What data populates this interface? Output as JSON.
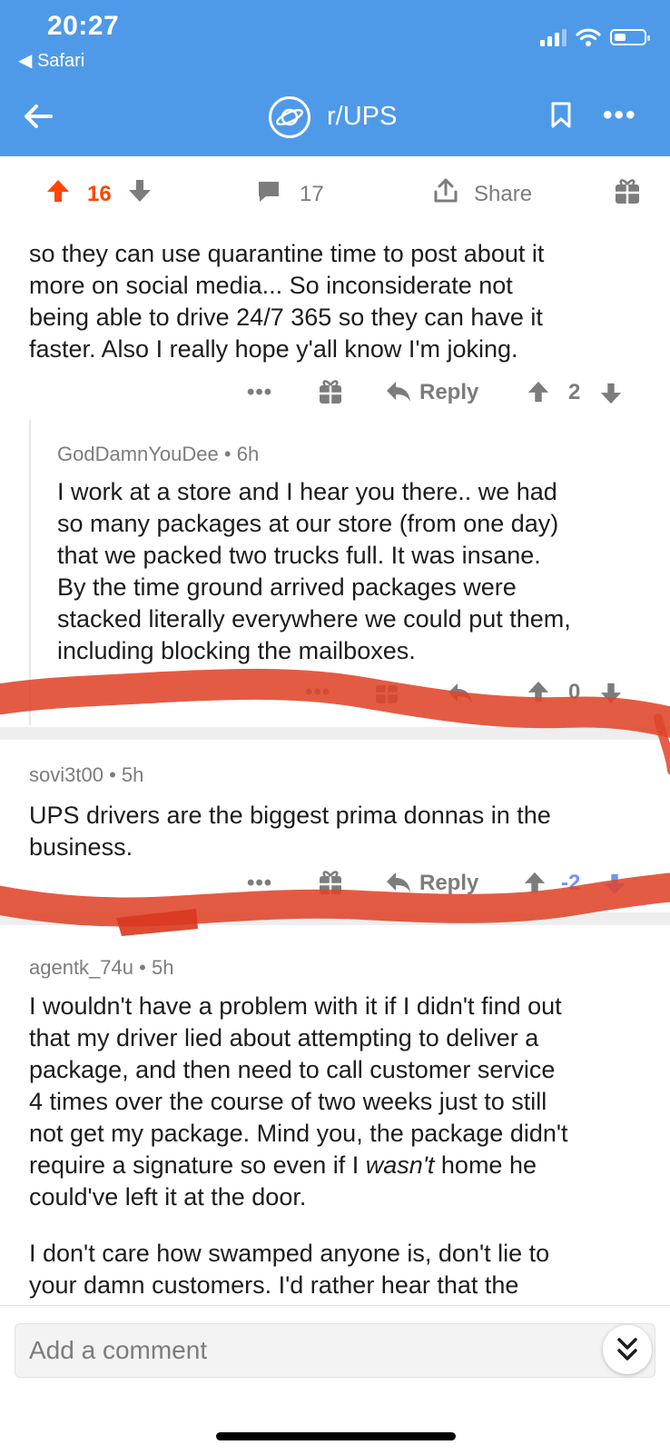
{
  "status_bar": {
    "time": "20:27",
    "back_app": "◀ Safari"
  },
  "header": {
    "subreddit": "r/UPS"
  },
  "post_bar": {
    "upvotes": "16",
    "comments": "17",
    "share_label": "Share"
  },
  "comments": [
    {
      "text_lines": [
        "so they can use quarantine time to post about it",
        "more on social media... So inconsiderate not",
        "being able to drive 24/7 365 so they can have it",
        "faster. Also I really hope y'all know I'm joking."
      ],
      "reply_label": "Reply",
      "score": "2"
    },
    {
      "author": "GodDamnYouDee",
      "age": "6h",
      "text_lines": [
        "I work at a store and I hear you there.. we had",
        "so many packages at our store (from one day)",
        "that we packed two trucks full. It was insane.",
        "By the time ground arrived packages were",
        "stacked literally everywhere we could put them,",
        "including blocking the mailboxes."
      ],
      "score": "0"
    },
    {
      "author": "sovi3t00",
      "age": "5h",
      "text_lines": [
        "UPS drivers are the biggest prima donnas in the",
        "business."
      ],
      "reply_label": "Reply",
      "score": "-2"
    },
    {
      "author": "agentk_74u",
      "age": "5h",
      "text_lines": [
        "I wouldn't have a problem with it if I didn't find out",
        "that my driver lied about attempting to deliver a",
        "package, and then need to call customer service",
        "4 times over the course of two weeks just to still",
        "not get my package. Mind you, the package didn't"
      ],
      "line6_before": "require a signature so even if I ",
      "line6_em": "wasn't",
      "line6_after": " home he",
      "line7": "could've left it at the door.",
      "para2_lines": [
        "I don't care how swamped anyone is, don't lie to",
        "your damn customers. I'd rather hear that the"
      ]
    }
  ],
  "comment_input": {
    "placeholder": "Add a comment"
  },
  "meta_sep": "•",
  "colors": {
    "header_bg": "#4f9ae8",
    "upvote": "#ff4500",
    "downvote": "#7193ff",
    "scribble": "#e0442a",
    "meta": "#7c7c7c"
  }
}
